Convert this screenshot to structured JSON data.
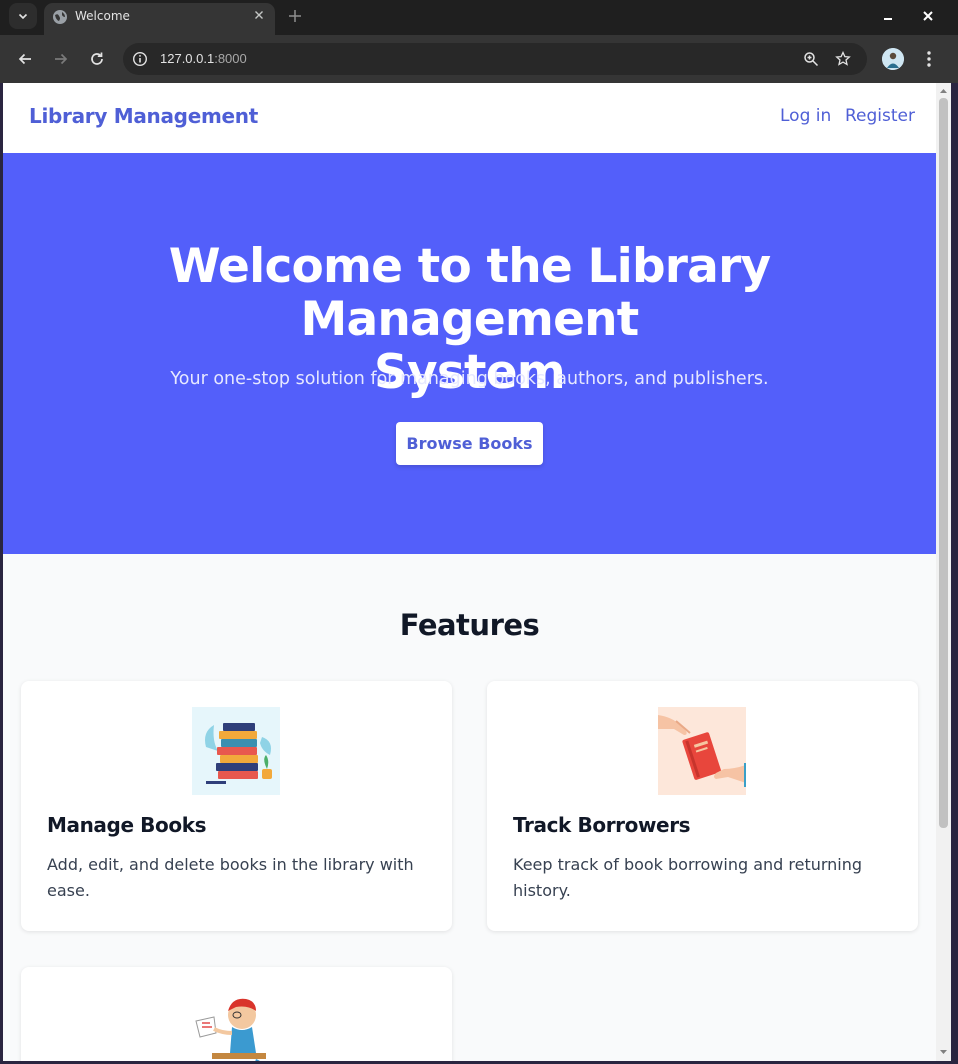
{
  "browser": {
    "tab_title": "Welcome",
    "url_host": "127.0.0.1",
    "url_port": ":8000"
  },
  "site": {
    "brand": "Library Management",
    "nav": {
      "login": "Log in",
      "register": "Register"
    }
  },
  "hero": {
    "title_line1": "Welcome to the Library Management",
    "title_line2": "System",
    "subtitle": "Your one-stop solution for managing books, authors, and publishers.",
    "cta": "Browse Books"
  },
  "features": {
    "heading": "Features",
    "cards": [
      {
        "title": "Manage Books",
        "description": "Add, edit, and delete books in the library with ease.",
        "image_icon": "stacked-books-illustration"
      },
      {
        "title": "Track Borrowers",
        "description": "Keep track of book borrowing and returning history.",
        "image_icon": "book-handoff-illustration"
      },
      {
        "title": "",
        "description": "",
        "image_icon": "reading-person-illustration"
      }
    ]
  },
  "colors": {
    "brand": "#4f5fd6",
    "hero_bg": "#535ffa"
  }
}
